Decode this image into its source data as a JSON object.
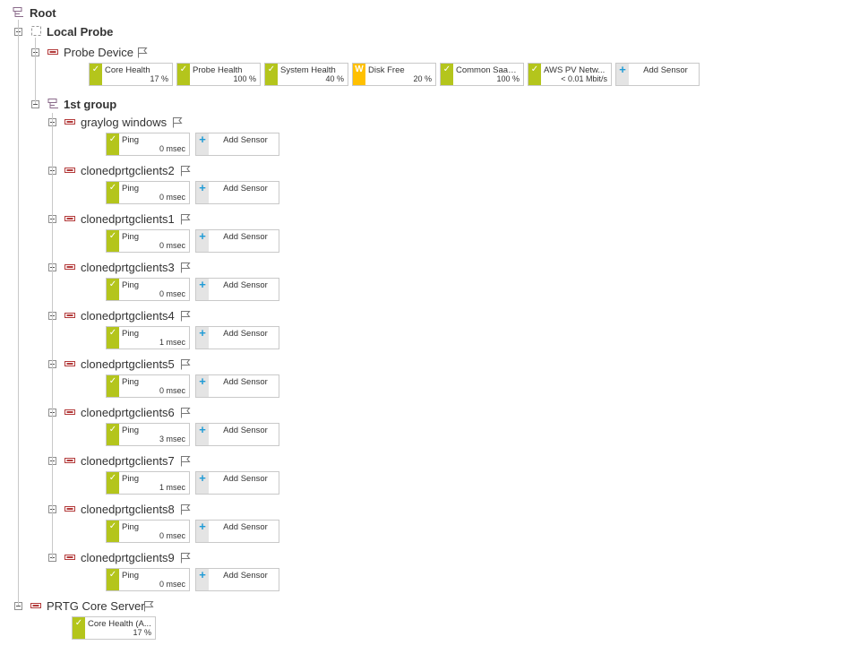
{
  "root": {
    "label": "Root"
  },
  "local_probe": {
    "label": "Local Probe"
  },
  "probe_device": {
    "label": "Probe Device",
    "sensors": [
      {
        "name": "Core Health",
        "value": "17 %",
        "status": "ok",
        "glyph": "✓"
      },
      {
        "name": "Probe Health",
        "value": "100 %",
        "status": "ok",
        "glyph": "✓"
      },
      {
        "name": "System Health",
        "value": "40 %",
        "status": "ok",
        "glyph": "✓"
      },
      {
        "name": "Disk Free",
        "value": "20 %",
        "status": "warn",
        "glyph": "W"
      },
      {
        "name": "Common SaaS...",
        "value": "100 %",
        "status": "ok",
        "glyph": "✓"
      },
      {
        "name": "AWS PV Netw...",
        "value": "< 0.01 Mbit/s",
        "status": "ok",
        "glyph": "✓"
      }
    ],
    "add_sensor": "Add Sensor"
  },
  "group": {
    "label": "1st group"
  },
  "devices": [
    {
      "label": "graylog windows",
      "sensor": "Ping",
      "value": "0 msec"
    },
    {
      "label": "clonedprtgclients2",
      "sensor": "Ping",
      "value": "0 msec"
    },
    {
      "label": "clonedprtgclients1",
      "sensor": "Ping",
      "value": "0 msec"
    },
    {
      "label": "clonedprtgclients3",
      "sensor": "Ping",
      "value": "0 msec"
    },
    {
      "label": "clonedprtgclients4",
      "sensor": "Ping",
      "value": "1 msec"
    },
    {
      "label": "clonedprtgclients5",
      "sensor": "Ping",
      "value": "0 msec"
    },
    {
      "label": "clonedprtgclients6",
      "sensor": "Ping",
      "value": "3 msec"
    },
    {
      "label": "clonedprtgclients7",
      "sensor": "Ping",
      "value": "1 msec"
    },
    {
      "label": "clonedprtgclients8",
      "sensor": "Ping",
      "value": "0 msec"
    },
    {
      "label": "clonedprtgclients9",
      "sensor": "Ping",
      "value": "0 msec"
    }
  ],
  "device_add_sensor": "Add Sensor",
  "core_server": {
    "label": "PRTG Core Server",
    "sensor": {
      "name": "Core Health (A...",
      "value": "17 %",
      "glyph": "✓"
    }
  },
  "colors": {
    "ok": "#b4c51c",
    "warn": "#ffc000",
    "add_bar": "#e4e4e4",
    "plus": "#1f9bd6",
    "device_icon": "#b33a3a"
  },
  "icons": {
    "group": "group-icon",
    "probe": "probe-icon",
    "device": "device-icon",
    "flag": "flag-icon",
    "check": "check-icon",
    "plus": "plus-icon",
    "warning": "warning-icon"
  }
}
